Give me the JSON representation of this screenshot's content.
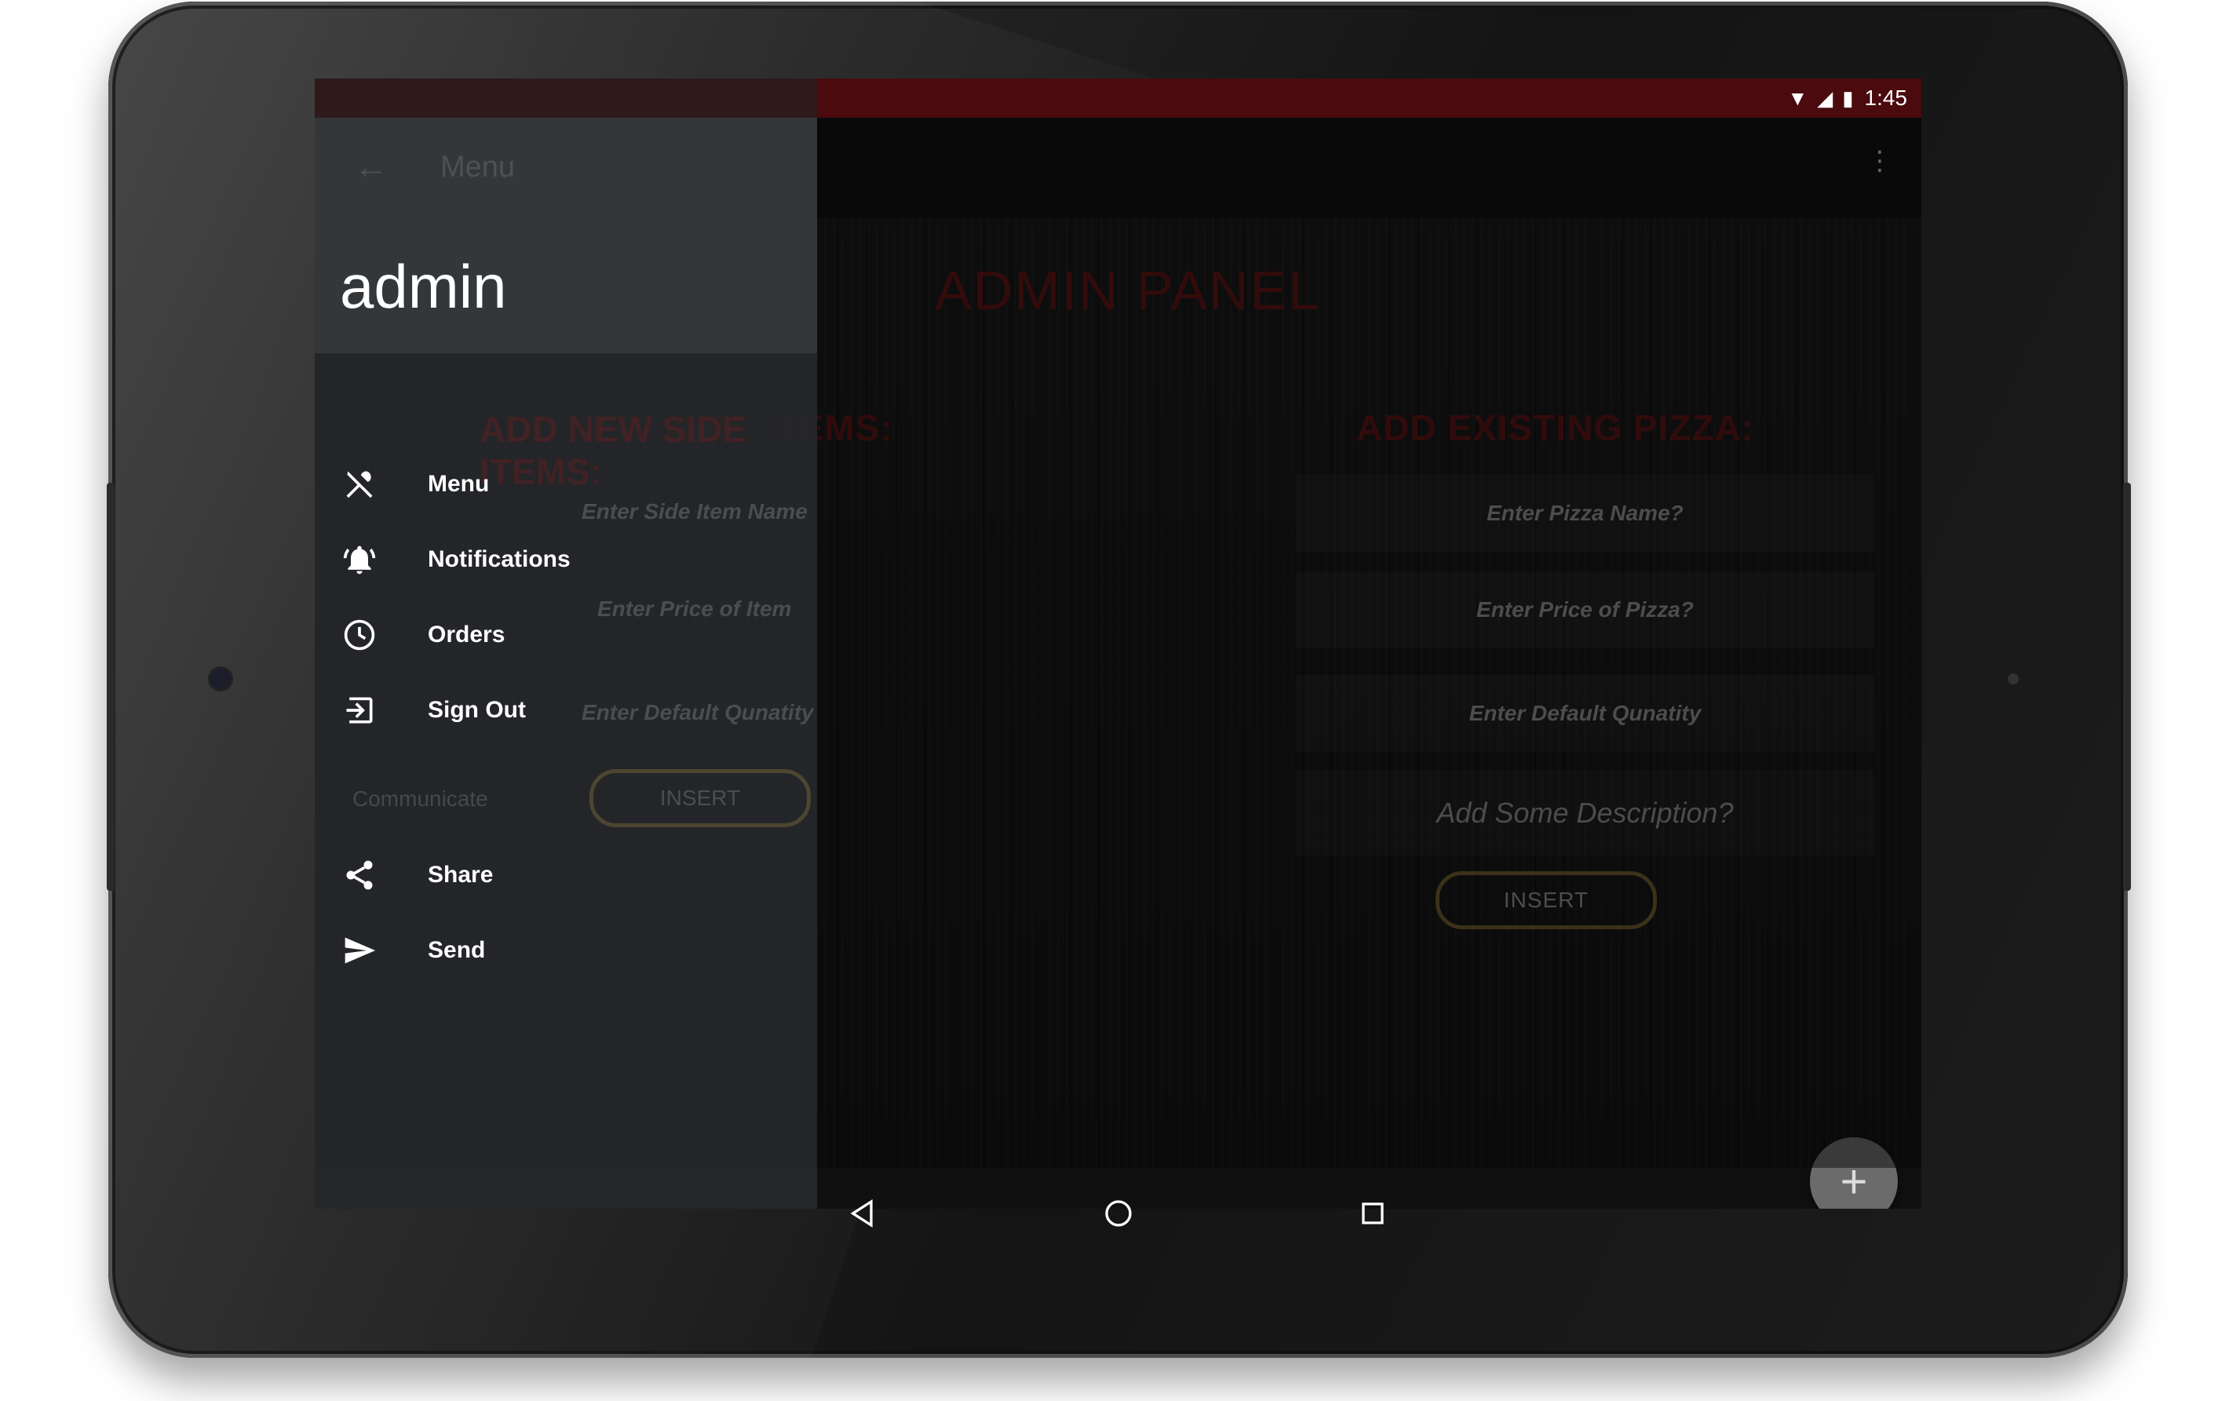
{
  "status_bar": {
    "time": "1:45"
  },
  "drawer": {
    "toolbar_title": "Menu",
    "user_name": "admin",
    "items": [
      {
        "label": "Menu",
        "icon": "fork-knife-icon"
      },
      {
        "label": "Notifications",
        "icon": "alarm-bell-icon"
      },
      {
        "label": "Orders",
        "icon": "clock-icon"
      },
      {
        "label": "Sign Out",
        "icon": "sign-out-icon"
      }
    ],
    "section_label": "Communicate",
    "section_items": [
      {
        "label": "Share",
        "icon": "share-icon"
      },
      {
        "label": "Send",
        "icon": "send-icon"
      }
    ]
  },
  "main": {
    "title": "ADMIN PANEL",
    "side_items": {
      "heading": "ADD NEW SIDE ITEMS:",
      "name_placeholder": "Enter Side Item Name",
      "price_placeholder": "Enter Price of Item",
      "qty_placeholder": "Enter Default Qunatity",
      "insert_label": "INSERT"
    },
    "pizza": {
      "heading": "ADD EXISTING PIZZA:",
      "name_placeholder": "Enter Pizza Name?",
      "price_placeholder": "Enter Price of Pizza?",
      "qty_placeholder": "Enter Default Qunatity",
      "desc_placeholder": "Add Some Description?",
      "insert_label": "INSERT"
    },
    "fab_label": "+"
  },
  "colors": {
    "status_bar": "#4a0a0e",
    "title_red": "#5e1414",
    "insert_border": "#6b5a2a",
    "drawer_bg": "#26282b"
  }
}
